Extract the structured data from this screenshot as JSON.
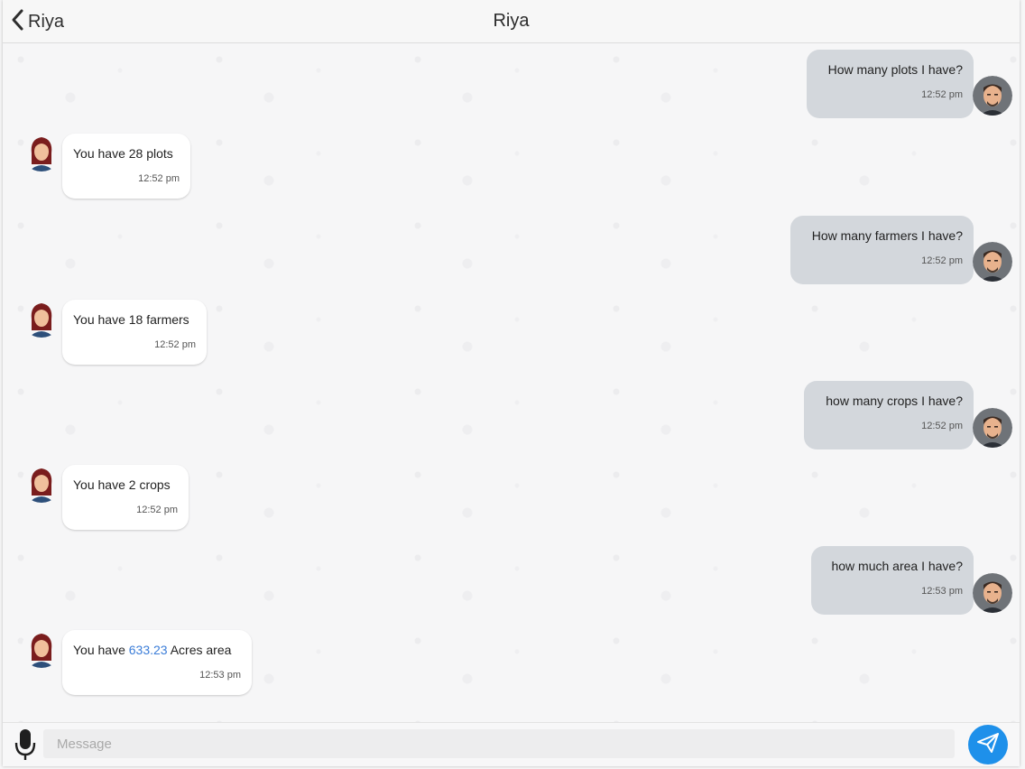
{
  "header": {
    "back_label": "Riya",
    "title": "Riya"
  },
  "messages": [
    {
      "from": "user",
      "text": "How many plots I have?",
      "time": "12:52 pm"
    },
    {
      "from": "bot",
      "text": "You have 28 plots",
      "time": "12:52 pm"
    },
    {
      "from": "user",
      "text": "How many farmers I have?",
      "time": "12:52 pm"
    },
    {
      "from": "bot",
      "text": "You have 18 farmers",
      "time": "12:52 pm"
    },
    {
      "from": "user",
      "text": "how many crops I have?",
      "time": "12:52 pm"
    },
    {
      "from": "bot",
      "text": "You have 2 crops",
      "time": "12:52 pm"
    },
    {
      "from": "user",
      "text": "how much area I have?",
      "time": "12:53 pm"
    },
    {
      "from": "bot",
      "text_before": "You have ",
      "link": "633.23",
      "text_after": " Acres area",
      "time": "12:53 pm"
    }
  ],
  "composer": {
    "placeholder": "Message",
    "value": ""
  },
  "icons": {
    "back": "chevron-left-icon",
    "mic": "microphone-icon",
    "send": "paper-plane-icon",
    "user_avatar": "male-avatar",
    "bot_avatar": "female-avatar"
  },
  "colors": {
    "outgoing_bubble": "#d3d7dc",
    "incoming_bubble": "#ffffff",
    "link": "#3b7dd8",
    "send_button": "#1e90ea"
  }
}
